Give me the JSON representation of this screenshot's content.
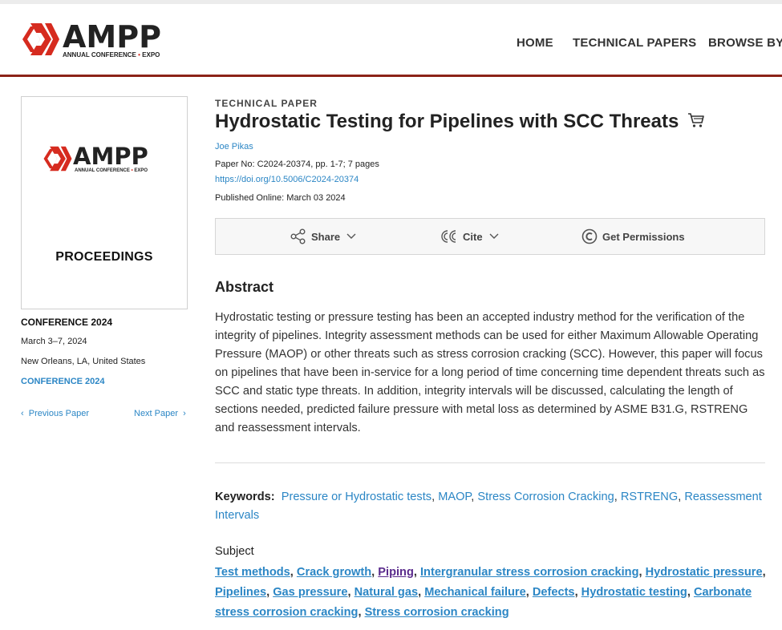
{
  "header": {
    "logo_text": "AMPP",
    "logo_sub_a": "ANNUAL CONFERENCE",
    "logo_sub_dot": "•",
    "logo_sub_b": "EXPO",
    "nav": [
      "HOME",
      "TECHNICAL PAPERS",
      "BROWSE BY"
    ],
    "accent_color": "#8c2318",
    "brand_red": "#d62b1f"
  },
  "sidebar": {
    "cover_logo_text": "AMPP",
    "cover_logo_sub_a": "ANNUAL CONFERENCE",
    "cover_logo_sub_dot": "•",
    "cover_logo_sub_b": "EXPO",
    "cover_label": "PROCEEDINGS",
    "conference": "CONFERENCE 2024",
    "dates": "March 3–7, 2024",
    "location": "New Orleans, LA, United States",
    "conference_link": "CONFERENCE 2024",
    "prev_label": "Previous Paper",
    "next_label": "Next Paper"
  },
  "paper": {
    "kicker": "TECHNICAL PAPER",
    "title": "Hydrostatic Testing for Pipelines with SCC Threats",
    "author": "Joe Pikas",
    "paper_no": "Paper No: C2024-20374, pp. 1-7; 7 pages",
    "doi": "https://doi.org/10.5006/C2024-20374",
    "published": "Published Online: March 03 2024"
  },
  "actions": {
    "share": "Share",
    "cite": "Cite",
    "permissions": "Get Permissions"
  },
  "abstract": {
    "heading": "Abstract",
    "text": "Hydrostatic testing or pressure testing has been an accepted industry method for the verification of the integrity of pipelines. Integrity assessment methods can be used for either Maximum Allowable Operating Pressure (MAOP) or other threats such as stress corrosion cracking (SCC). However, this paper will focus on pipelines that have been in-service for a long period of time concerning time dependent threats such as SCC and static type threats. In addition, integrity intervals will be discussed, calculating the length of sections needed, predicted failure pressure with metal loss as determined by ASME B31.G, RSTRENG and reassessment intervals."
  },
  "keywords": {
    "label": "Keywords:",
    "items": [
      "Pressure or Hydrostatic tests",
      "MAOP",
      "Stress Corrosion Cracking",
      "RSTRENG",
      "Reassessment Intervals"
    ]
  },
  "subjects": {
    "label": "Subject",
    "items": [
      "Test methods",
      "Crack growth",
      "Piping",
      "Intergranular stress corrosion cracking",
      "Hydrostatic pressure",
      "Pipelines",
      "Gas pressure",
      "Natural gas",
      "Mechanical failure",
      "Defects",
      "Hydrostatic testing",
      "Carbonate stress corrosion cracking",
      "Stress corrosion cracking"
    ],
    "link_color": "#2b86c5",
    "visited_color": "#5a2b8c"
  }
}
